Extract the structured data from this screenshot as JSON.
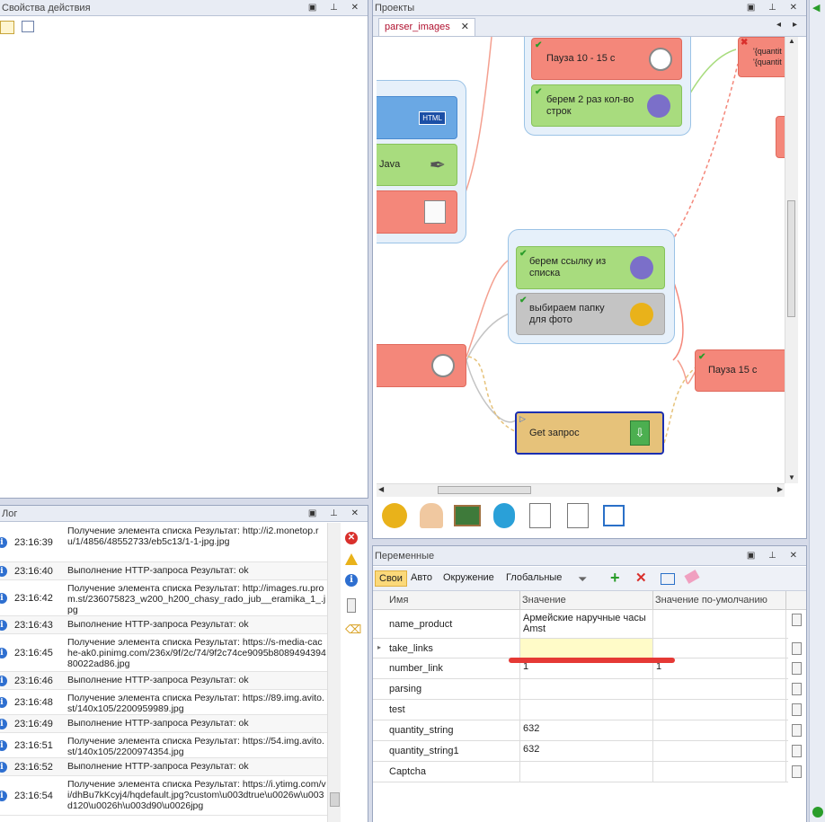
{
  "action_props": {
    "title": "Свойства действия"
  },
  "projects": {
    "title": "Проекты",
    "tab_label": "parser_images",
    "nodes": {
      "pause1015": "Пауза 10 - 15 с",
      "take2": "берем 2 раз кол-во строк",
      "java": "Java",
      "html": "HTML",
      "quote": "\"",
      "take_link": "берем ссылку из списка",
      "choose_folder": "выбираем папку для фото",
      "pause15": "Пауза 15 с",
      "get": "Get запрос",
      "quantity1": "'{quantit",
      "quantity2": "'{quantit"
    }
  },
  "log": {
    "title": "Лог",
    "entries": [
      {
        "time": "23:16:39",
        "message": "Получение элемента списка  Результат: http://i2.monetop.ru/1/4856/48552733/eb5c13/1-1-jpg.jpg"
      },
      {
        "time": "23:16:40",
        "message": "Выполнение HTTP-запроса  Результат: ok"
      },
      {
        "time": "23:16:42",
        "message": "Получение элемента списка  Результат: http://images.ru.prom.st/236075823_w200_h200_chasy_rado_jub__eramika_1_.jpg"
      },
      {
        "time": "23:16:43",
        "message": "Выполнение HTTP-запроса  Результат: ok"
      },
      {
        "time": "23:16:45",
        "message": "Получение элемента списка  Результат: https://s-media-cache-ak0.pinimg.com/236x/9f/2c/74/9f2c74ce9095b808949439480022ad86.jpg"
      },
      {
        "time": "23:16:46",
        "message": "Выполнение HTTP-запроса  Результат: ok"
      },
      {
        "time": "23:16:48",
        "message": "Получение элемента списка  Результат: https://89.img.avito.st/140x105/2200959989.jpg"
      },
      {
        "time": "23:16:49",
        "message": "Выполнение HTTP-запроса  Результат: ok"
      },
      {
        "time": "23:16:51",
        "message": "Получение элемента списка  Результат: https://54.img.avito.st/140x105/2200974354.jpg"
      },
      {
        "time": "23:16:52",
        "message": "Выполнение HTTP-запроса  Результат: ok"
      },
      {
        "time": "23:16:54",
        "message": "Получение элемента списка  Результат: https://i.ytimg.com/vi/dhBu7kKcyj4/hqdefault.jpg?custom\\u003dtrue\\u0026w\\u003d120\\u0026h\\u003d90\\u0026jpg"
      }
    ]
  },
  "variables": {
    "title": "Переменные",
    "tabs": [
      "Свои",
      "Авто",
      "Окружение",
      "Глобальные"
    ],
    "columns": [
      "Имя",
      "Значение",
      "Значение по-умолчанию"
    ],
    "rows": [
      {
        "name": "name_product",
        "value": "Армейские наручные часы Amst",
        "default": ""
      },
      {
        "name": "take_links",
        "value": "",
        "default": ""
      },
      {
        "name": "number_link",
        "value": "1",
        "default": "1"
      },
      {
        "name": "parsing",
        "value": "",
        "default": ""
      },
      {
        "name": "test",
        "value": "",
        "default": ""
      },
      {
        "name": "quantity_string",
        "value": "632",
        "default": ""
      },
      {
        "name": "quantity_string1",
        "value": "632",
        "default": ""
      },
      {
        "name": "Captcha",
        "value": "",
        "default": ""
      }
    ]
  },
  "colors": {
    "red_node": "#f4877a",
    "green_node": "#a8dc7e",
    "blue_node": "#6aa8e4",
    "gray_node": "#c4c4c4",
    "gold_node": "#e6c27a",
    "accent_tab": "#b0102e"
  }
}
